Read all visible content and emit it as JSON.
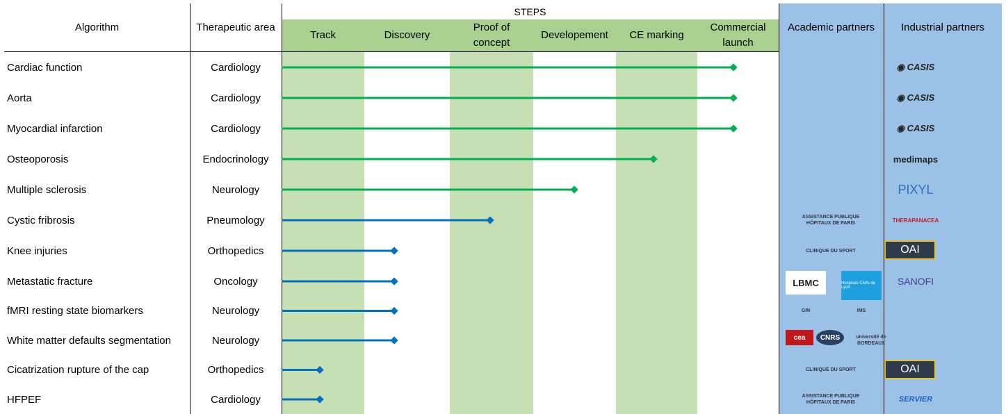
{
  "headers": {
    "algorithm": "Algorithm",
    "therapeutic_area": "Therapeutic area",
    "steps": "STEPS",
    "academic": "Academic partners",
    "industrial": "Industrial partners"
  },
  "steps": [
    "Track",
    "Discovery",
    "Proof of concept",
    "Developement",
    "CE marking",
    "Commercial launch"
  ],
  "colors": {
    "green_bar": "#00b050",
    "blue_bar": "#0070c0",
    "step_shade": "#c6e0b4",
    "step_header": "#a9d08e",
    "partner_bg": "#9bc2e6"
  },
  "rows": [
    {
      "algorithm": "Cardiac function",
      "area": "Cardiology",
      "stage_reached": "Commercial launch",
      "color": "green",
      "academic": [],
      "industrial": [
        "CASIS"
      ]
    },
    {
      "algorithm": "Aorta",
      "area": "Cardiology",
      "stage_reached": "Commercial launch",
      "color": "green",
      "academic": [],
      "industrial": [
        "CASIS"
      ]
    },
    {
      "algorithm": "Myocardial infarction",
      "area": "Cardiology",
      "stage_reached": "Commercial launch",
      "color": "green",
      "academic": [],
      "industrial": [
        "CASIS"
      ]
    },
    {
      "algorithm": "Osteoporosis",
      "area": "Endocrinology",
      "stage_reached": "CE marking",
      "color": "green",
      "academic": [],
      "industrial": [
        "medimaps"
      ]
    },
    {
      "algorithm": "Multiple sclerosis",
      "area": "Neurology",
      "stage_reached": "Developement",
      "color": "green",
      "academic": [],
      "industrial": [
        "PIXYL"
      ]
    },
    {
      "algorithm": "Cystic fribrosis",
      "area": "Pneumology",
      "stage_reached": "Proof of concept",
      "color": "blue",
      "academic": [
        "ASSISTANCE PUBLIQUE HÔPITAUX DE PARIS"
      ],
      "industrial": [
        "THERAPANACEA"
      ]
    },
    {
      "algorithm": "Knee injuries",
      "area": "Orthopedics",
      "stage_reached": "Discovery",
      "color": "blue",
      "academic": [
        "CLINIQUE DU SPORT"
      ],
      "industrial": [
        "OAI"
      ]
    },
    {
      "algorithm": "Metastatic fracture",
      "area": "Oncology",
      "stage_reached": "Discovery",
      "color": "blue",
      "academic": [
        "LBMC",
        "Hospices Civils de Lyon"
      ],
      "industrial": [
        "SANOFI"
      ]
    },
    {
      "algorithm": "fMRI resting state biomarkers",
      "area": "Neurology",
      "stage_reached": "Discovery",
      "color": "blue",
      "academic": [
        "GIN",
        "IMS"
      ],
      "industrial": []
    },
    {
      "algorithm": "White matter defaults segmentation",
      "area": "Neurology",
      "stage_reached": "Discovery",
      "color": "blue",
      "academic": [
        "cea",
        "CNRS",
        "université de BORDEAUX"
      ],
      "industrial": []
    },
    {
      "algorithm": "Cicatrization rupture of the cap",
      "area": "Orthopedics",
      "stage_reached": "Track",
      "color": "blue",
      "academic": [
        "CLINIQUE DU SPORT"
      ],
      "industrial": [
        "OAI"
      ]
    },
    {
      "algorithm": "HFPEF",
      "area": "Cardiology",
      "stage_reached": "Track",
      "color": "blue",
      "academic": [
        "ASSISTANCE PUBLIQUE HÔPITAUX DE PARIS"
      ],
      "industrial": [
        "SERVIER"
      ]
    }
  ]
}
